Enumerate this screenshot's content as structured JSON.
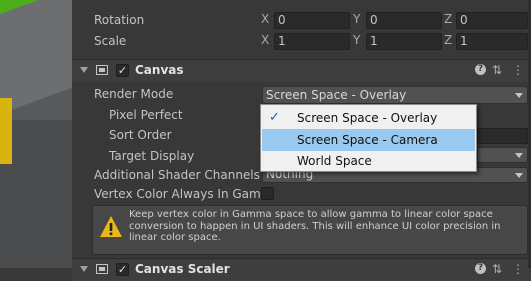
{
  "transform": {
    "rotation": {
      "label": "Rotation",
      "x": "X",
      "y": "Y",
      "z": "Z",
      "vx": "0",
      "vy": "0",
      "vz": "0"
    },
    "scale": {
      "label": "Scale",
      "x": "X",
      "y": "Y",
      "z": "Z",
      "vx": "1",
      "vy": "1",
      "vz": "1"
    }
  },
  "canvas": {
    "title": "Canvas",
    "enabled": "✓",
    "render_mode_label": "Render Mode",
    "render_mode_value": "Screen Space - Overlay",
    "pixel_perfect_label": "Pixel Perfect",
    "sort_order_label": "Sort Order",
    "target_display_label": "Target Display",
    "additional_shader_channels_label": "Additional Shader Channels",
    "additional_shader_channels_value": "Nothing",
    "vertex_color_label": "Vertex Color Always In Gamm",
    "help_text": "Keep vertex color in Gamma space to allow gamma to linear color space conversion to happen in UI shaders. This will enhance UI color precision in linear color space."
  },
  "menu": {
    "items": [
      {
        "label": "Screen Space - Overlay",
        "check": "✓"
      },
      {
        "label": "Screen Space - Camera"
      },
      {
        "label": "World Space"
      }
    ]
  },
  "canvas_scaler": {
    "title": "Canvas Scaler",
    "enabled": "✓"
  },
  "icons": {
    "help": "?",
    "settings": "⇅",
    "more": "⋮"
  },
  "colors": {
    "menu_highlight": "#99c9ef",
    "checkmark": "#1a5fb4",
    "warning": "#e8b818"
  }
}
